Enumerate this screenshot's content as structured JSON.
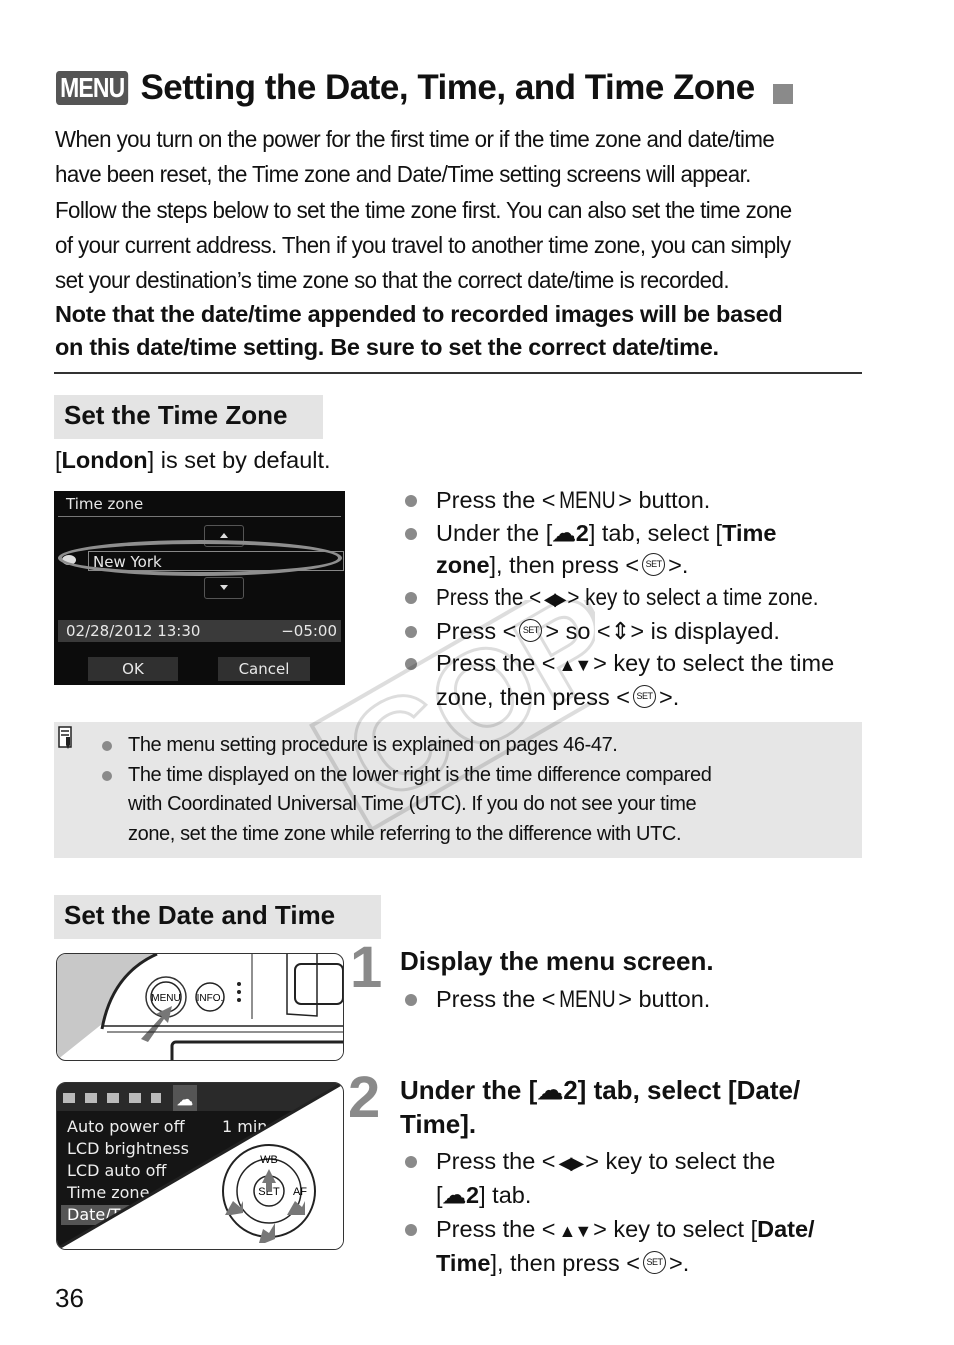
{
  "title": {
    "badge": "MENU",
    "text": "Setting the Date, Time, and Time Zone"
  },
  "intro": {
    "lines": [
      "When you turn on the power for the first time or if the time zone and date/time",
      "have been reset, the Time zone and Date/Time setting screens will appear.",
      "Follow the steps below to set the time zone first. You can also set the time zone",
      "of your current address. Then if you travel to another time zone, you can simply",
      "set your destination’s time zone so that the correct date/time is recorded."
    ],
    "note_lines": [
      "Note that the date/time appended to recorded images will be based",
      "on this date/time setting. Be sure to set the correct date/time."
    ]
  },
  "time_zone_section": {
    "heading": "Set the Time Zone",
    "default_prefix": "[",
    "default_city": "London",
    "default_suffix": "] is set by default.",
    "camera_screen": {
      "title": "Time zone",
      "city": "New York",
      "datetime": "02/28/2012 13:30",
      "utc_offset": "−05:00",
      "ok_label": "OK",
      "cancel_label": "Cancel"
    },
    "bullets": {
      "b1_pre": "Press the <",
      "b1_menu": "MENU",
      "b1_post": "> button.",
      "b2_pre": "Under the [",
      "b2_tab": "☁2",
      "b2_mid": "] tab, select [",
      "b2_bold1": "Time",
      "b2_bold2": "zone",
      "b2_post": "], then press <",
      "b2_end": ">.",
      "b3_pre": "Press the <",
      "b3_arrows": "◀▶",
      "b3_post": "> key to select a time zone.",
      "b4_pre": "Press <",
      "b4_mid": "> so <",
      "b4_icon": "⇕",
      "b4_post": "> is displayed.",
      "b5_pre": "Press the <",
      "b5_arrows": "▲▼",
      "b5_post": "> key to select the time",
      "b5_line2": "zone, then press <",
      "b5_end": ">.",
      "set_label": "SET"
    }
  },
  "memo": {
    "items": [
      "The menu setting procedure is explained on pages 46-47.",
      "The time displayed on the lower right is the time difference compared",
      "with Coordinated Universal Time (UTC). If you do not see your time",
      "zone, set the time zone while referring to the difference with UTC."
    ]
  },
  "watermark": "COPY",
  "date_time_section": {
    "heading": "Set the Date and Time",
    "steps": [
      {
        "number": "1",
        "title": "Display the menu screen.",
        "bullet_pre": "Press the <",
        "bullet_menu": "MENU",
        "bullet_post": "> button.",
        "illustration": {
          "menu_button": "MENU",
          "info_button": "INFO."
        }
      },
      {
        "number": "2",
        "title_line1": "Under the [☁2] tab, select [Date/",
        "title_line2": "Time].",
        "b1_pre": "Press the <",
        "b1_arrows": "◀▶",
        "b1_post": "> key to select the",
        "b1_line2_pre": "[",
        "b1_line2_tab": "☁2",
        "b1_line2_post": "] tab.",
        "b2_pre": "Press the <",
        "b2_arrows": "▲▼",
        "b2_post": "> key to select [",
        "b2_bold1": "Date/",
        "b2_bold2": "Time",
        "b2_line2_post": "], then press <",
        "b2_end": ">.",
        "illustration": {
          "menu_items": [
            "Auto power off",
            "LCD brightness",
            "LCD auto off",
            "Time zone",
            "Date/T"
          ],
          "auto_power_value": "1 min",
          "dial_labels": {
            "top": "WB",
            "center": "SET",
            "right": "AF"
          }
        }
      }
    ]
  },
  "page_number": "36"
}
